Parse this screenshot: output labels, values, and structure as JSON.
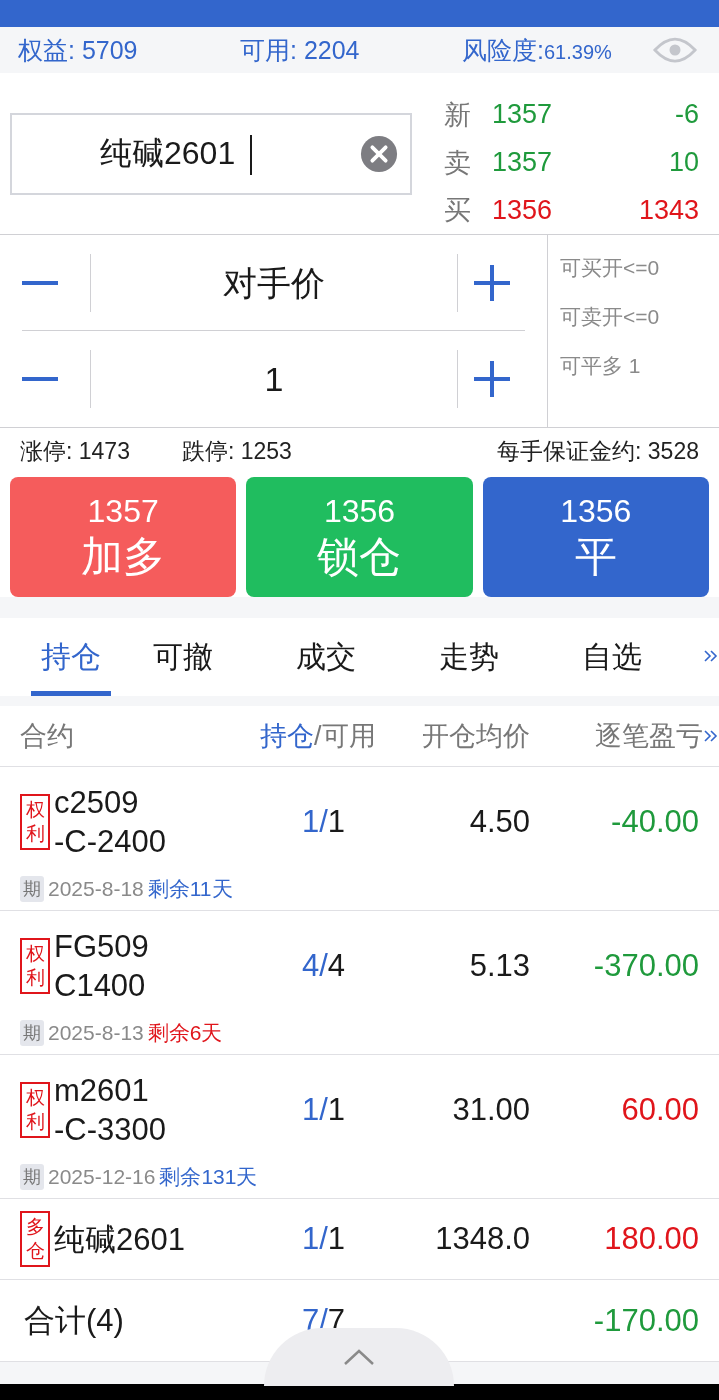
{
  "account": {
    "equity": "权益: 5709",
    "available": "可用: 2204",
    "risk_label": "风险度:",
    "risk_value": "61.39%"
  },
  "contract_field": {
    "value": "纯碱2601"
  },
  "quotes": [
    {
      "label": "新",
      "price": "1357",
      "volume": "-6",
      "color": "#1f9a3c"
    },
    {
      "label": "卖",
      "price": "1357",
      "volume": "10",
      "color": "#1f9a3c"
    },
    {
      "label": "买",
      "price": "1356",
      "volume": "1343",
      "color": "#e0151b"
    }
  ],
  "order": {
    "price_type": "对手价",
    "quantity": "1",
    "limits": [
      "可买开<=0",
      "可卖开<=0",
      "可平多 1"
    ]
  },
  "limit_up": "涨停: 1473",
  "limit_down": "跌停: 1253",
  "margin": "每手保证金约: 3528",
  "actions": [
    {
      "kind": "buy",
      "price": "1357",
      "label": "加多"
    },
    {
      "kind": "lock",
      "price": "1356",
      "label": "锁仓"
    },
    {
      "kind": "close",
      "price": "1356",
      "label": "平"
    }
  ],
  "tabs": [
    {
      "label": "持仓",
      "selected": true
    },
    {
      "label": "可撤",
      "selected": false
    },
    {
      "label": "成交",
      "selected": false
    },
    {
      "label": "走势",
      "selected": false
    },
    {
      "label": "自选",
      "selected": false
    }
  ],
  "table": {
    "columns": {
      "contract": "合约",
      "hold": "持仓",
      "available": "/可用",
      "avg_price": "开仓均价",
      "pnl": "逐笔盈亏"
    },
    "rows": [
      {
        "tag": [
          "权",
          "利"
        ],
        "name_lines": [
          "c2509",
          "-C-2400"
        ],
        "hold": "1/",
        "available": "1",
        "avg_price": "4.50",
        "pnl": "-40.00",
        "color": "#1f9a3c",
        "expiry": {
          "badge": "期",
          "date": "2025-8-18",
          "remaining": "剩余11天",
          "urgent": false
        }
      },
      {
        "tag": [
          "权",
          "利"
        ],
        "name_lines": [
          "FG509",
          "C1400"
        ],
        "hold": "4/",
        "available": "4",
        "avg_price": "5.13",
        "pnl": "-370.00",
        "color": "#1f9a3c",
        "expiry": {
          "badge": "期",
          "date": "2025-8-13",
          "remaining": "剩余6天",
          "urgent": true
        }
      },
      {
        "tag": [
          "权",
          "利"
        ],
        "name_lines": [
          "m2601",
          "-C-3300"
        ],
        "hold": "1/",
        "available": "1",
        "avg_price": "31.00",
        "pnl": "60.00",
        "color": "#e0151b",
        "expiry": {
          "badge": "期",
          "date": "2025-12-16",
          "remaining": "剩余131天",
          "urgent": false
        }
      },
      {
        "tag": [
          "多",
          "仓"
        ],
        "name_lines": [
          "纯碱2601"
        ],
        "hold": "1/",
        "available": "1",
        "avg_price": "1348.0",
        "pnl": "180.00",
        "color": "#e0151b"
      }
    ],
    "total": {
      "label": "合计(4)",
      "hold": "7/",
      "available": "7",
      "pnl": "-170.00",
      "color": "#1f9a3c"
    }
  }
}
